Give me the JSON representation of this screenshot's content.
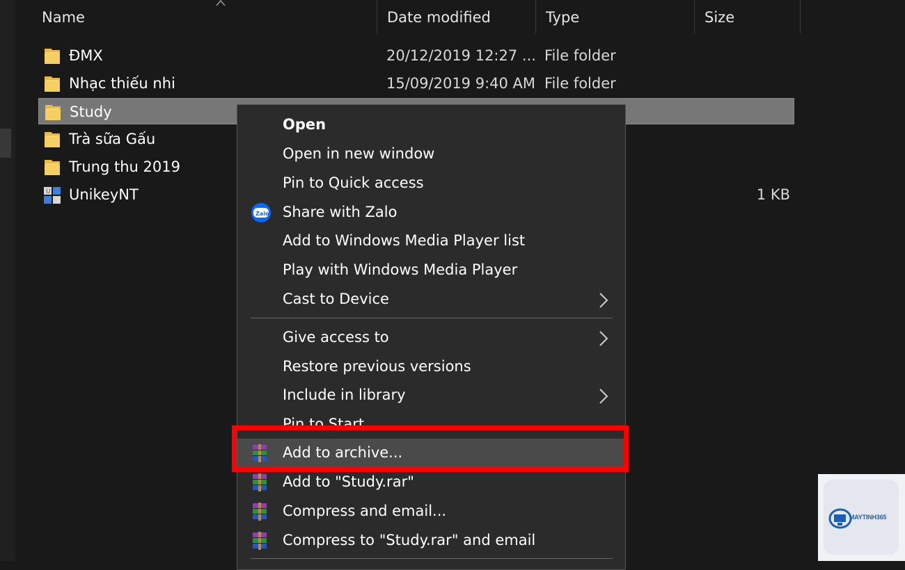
{
  "header": {
    "name": "Name",
    "date_modified": "Date modified",
    "type": "Type",
    "size": "Size"
  },
  "files": [
    {
      "name": "ĐMX",
      "date": "20/12/2019 12:27 ...",
      "type": "File folder",
      "size": "",
      "icon": "folder-icon"
    },
    {
      "name": "Nhạc thiếu nhi",
      "date": "15/09/2019 9:40 AM",
      "type": "File folder",
      "size": "",
      "icon": "folder-icon"
    },
    {
      "name": "Study",
      "date": "",
      "type": "",
      "size": "",
      "icon": "folder-icon",
      "selected": true
    },
    {
      "name": "Trà sữa Gấu",
      "date": "",
      "type": "",
      "size": "",
      "icon": "folder-icon"
    },
    {
      "name": "Trung thu 2019",
      "date": "",
      "type": "",
      "size": "",
      "icon": "folder-icon"
    },
    {
      "name": "UnikeyNT",
      "date": "",
      "type": "",
      "size": "1 KB",
      "icon": "unikey-app-icon"
    }
  ],
  "context_menu": {
    "items": [
      {
        "label": "Open",
        "bold": true
      },
      {
        "label": "Open in new window"
      },
      {
        "label": "Pin to Quick access"
      },
      {
        "label": "Share with Zalo",
        "icon": "zalo-icon"
      },
      {
        "label": "Add to Windows Media Player list"
      },
      {
        "label": "Play with Windows Media Player"
      },
      {
        "label": "Cast to Device",
        "submenu": true
      },
      {
        "label": "Give access to",
        "submenu": true
      },
      {
        "label": "Restore previous versions"
      },
      {
        "label": "Include in library",
        "submenu": true
      },
      {
        "label": "Pin to Start"
      },
      {
        "label": "Add to archive...",
        "icon": "winrar-icon",
        "highlighted": true
      },
      {
        "label": "Add to \"Study.rar\"",
        "icon": "winrar-icon"
      },
      {
        "label": "Compress and email...",
        "icon": "winrar-icon"
      },
      {
        "label": "Compress to \"Study.rar\" and email",
        "icon": "winrar-icon"
      }
    ]
  },
  "watermark": {
    "brand": "MAYTINH365",
    "icon": "maytinh365-logo-icon"
  },
  "colors": {
    "background": "#191919",
    "menu_background": "#2b2b2b",
    "selected_row": "#777777",
    "highlight_box": "#ff0000",
    "folder_yellow": "#f8d775"
  }
}
